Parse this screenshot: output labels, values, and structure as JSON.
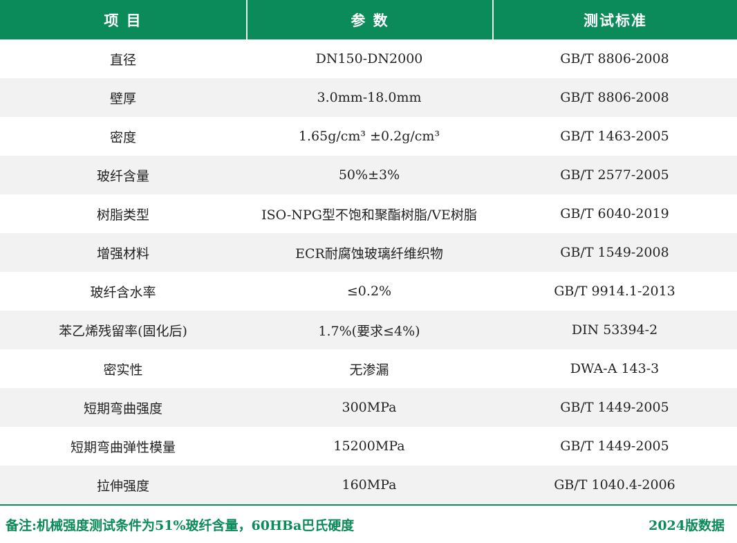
{
  "header": {
    "col_item": "项  目",
    "col_param": "参  数",
    "col_standard": "测试标准"
  },
  "rows": [
    {
      "item": "直径",
      "param": "DN150-DN2000",
      "standard": "GB/T 8806-2008"
    },
    {
      "item": "壁厚",
      "param": "3.0mm-18.0mm",
      "standard": "GB/T 8806-2008"
    },
    {
      "item": "密度",
      "param": "1.65g/cm³ ±0.2g/cm³",
      "standard": "GB/T 1463-2005"
    },
    {
      "item": "玻纤含量",
      "param": "50%±3%",
      "standard": "GB/T 2577-2005"
    },
    {
      "item": "树脂类型",
      "param": "ISO-NPG型不饱和聚酯树脂/VE树脂",
      "standard": "GB/T 6040-2019"
    },
    {
      "item": "增强材料",
      "param": "ECR耐腐蚀玻璃纤维织物",
      "standard": "GB/T 1549-2008"
    },
    {
      "item": "玻纤含水率",
      "param": "≤0.2%",
      "standard": "GB/T 9914.1-2013"
    },
    {
      "item": "苯乙烯残留率(固化后)",
      "param": "1.7%(要求≤4%)",
      "standard": "DIN 53394-2"
    },
    {
      "item": "密实性",
      "param": "无渗漏",
      "standard": "DWA-A 143-3"
    },
    {
      "item": "短期弯曲强度",
      "param": "300MPa",
      "standard": "GB/T 1449-2005"
    },
    {
      "item": "短期弯曲弹性模量",
      "param": "15200MPa",
      "standard": "GB/T 1449-2005"
    },
    {
      "item": "拉伸强度",
      "param": "160MPa",
      "standard": "GB/T 1040.4-2006"
    }
  ],
  "footer": {
    "note": "备注:机械强度测试条件为51%玻纤含量，60HBa巴氏硬度",
    "version": "2024版数据"
  },
  "colors": {
    "header_bg": "#0b8a5a",
    "footer_text": "#0b8a5a",
    "row_alt_bg": "#f2f2f2"
  }
}
